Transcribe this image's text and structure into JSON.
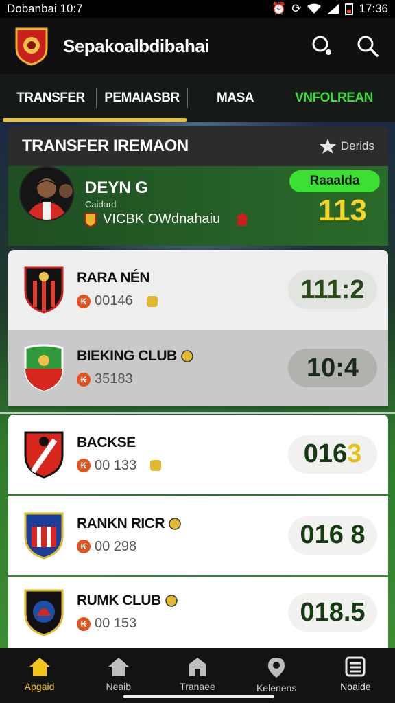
{
  "status_bar": {
    "carrier": "Dobanbai 10:7",
    "time": "17:36"
  },
  "app": {
    "title": "Sepakoalbdibahai"
  },
  "tabs": [
    {
      "label": "TRANSFER",
      "color": "#ffffff"
    },
    {
      "label": "PEMAIASBR",
      "color": "#ffffff"
    },
    {
      "label": "MASA",
      "color": "#ffffff"
    },
    {
      "label": "VNFOLREAN",
      "color": "#3ddc3d"
    }
  ],
  "panel": {
    "title": "TRANSFER IREMAON",
    "details_label": "Derids"
  },
  "featured": {
    "name": "DEYN G",
    "sub": "Caidard",
    "club": "VICBK OWdnahaiu",
    "pill": "Raaaldа",
    "score": "113"
  },
  "rows": [
    {
      "name": "RARA NÉN",
      "id": "00146",
      "score": "111:2",
      "score_color": "#2b4a1a"
    },
    {
      "name": "BIEKING CLUB",
      "id": "35183",
      "score": "10:4",
      "score_color": "#1a2a1a"
    },
    {
      "name": "BACKSE",
      "id": "00 133",
      "score_main": "016",
      "score_accent": "3",
      "accent_color": "#e5c21a"
    },
    {
      "name": "RANKN RICR",
      "id": "00 298",
      "score": "016 8",
      "score_color": "#163a12"
    },
    {
      "name": "RUMK CLUB",
      "id": "00 153",
      "score": "018.5",
      "score_color": "#163a12"
    }
  ],
  "nav": [
    {
      "label": "Apgaid",
      "icon": "home-icon"
    },
    {
      "label": "Neaib",
      "icon": "house-icon"
    },
    {
      "label": "Tranaee",
      "icon": "shop-icon"
    },
    {
      "label": "Kelenens",
      "icon": "location-icon"
    },
    {
      "label": "Noaide",
      "icon": "menu-icon"
    }
  ],
  "colors": {
    "accent": "#f2c31b",
    "green": "#3ce033",
    "header_bg": "#101010"
  }
}
